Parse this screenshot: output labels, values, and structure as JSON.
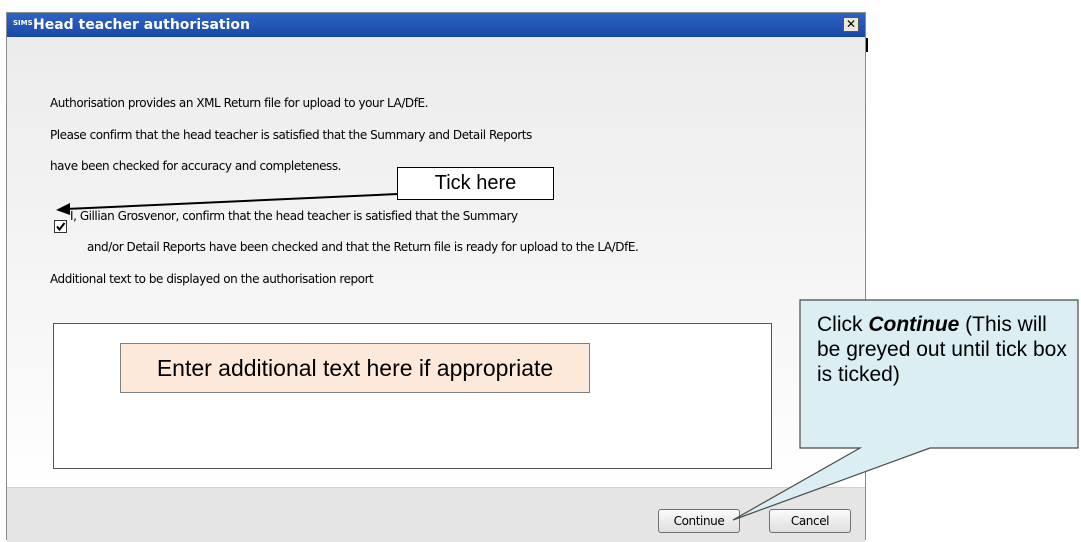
{
  "window": {
    "app_icon_text": "SIMS",
    "title": "Head teacher authorisation",
    "close_glyph": "✕"
  },
  "content": {
    "intro": "Authorisation provides an XML Return file for upload to your LA/DfE.",
    "confirm_line1": "Please confirm that the head teacher is satisfied that the Summary and Detail Reports",
    "confirm_line2": "have been checked for accuracy and completeness.",
    "checkbox_checked": true,
    "checkbox_line1": "I, Gillian Grosvenor, confirm that the head teacher is satisfied that the Summary",
    "checkbox_line2": "and/or Detail Reports have been checked and that the Return file is ready for upload to the LA/DfE.",
    "additional_label": "Additional text to be displayed on the authorisation report",
    "additional_text_value": ""
  },
  "buttons": {
    "continue": "Continue",
    "cancel": "Cancel"
  },
  "annotations": {
    "tick_here": "Tick here",
    "enter_text": "Enter additional text here if appropriate",
    "click_prefix": "Click ",
    "click_emphasis": "Continue",
    "click_suffix": " (This will be greyed out until tick box is ticked)"
  },
  "colors": {
    "titlebar": "#1948a7",
    "callout_blue": "#daeef3",
    "callout_peach": "#fde9d9"
  }
}
